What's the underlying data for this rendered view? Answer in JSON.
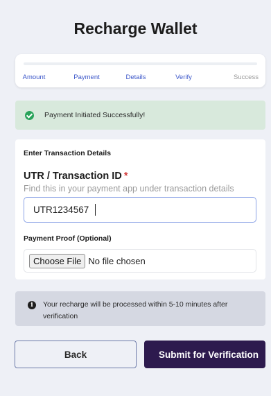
{
  "page": {
    "title": "Recharge Wallet"
  },
  "steps": [
    {
      "label": "Amount",
      "state": "done"
    },
    {
      "label": "Payment",
      "state": "done"
    },
    {
      "label": "Details",
      "state": "done"
    },
    {
      "label": "Verify",
      "state": "active"
    },
    {
      "label": "Success",
      "state": "pending"
    }
  ],
  "success_alert": {
    "message": "Payment Initiated Successfully!",
    "icon": "check-circle-icon"
  },
  "form": {
    "section_title": "Enter Transaction Details",
    "utr_label": "UTR / Transaction ID",
    "required_mark": "*",
    "utr_hint": "Find this in your payment app under transaction details",
    "utr_value": "UTR1234567",
    "proof_label": "Payment Proof (Optional)",
    "choose_file_label": "Choose File",
    "no_file_text": "No file chosen"
  },
  "info_alert": {
    "icon": "info-icon",
    "message": "Your recharge will be processed within 5-10 minutes after verification"
  },
  "buttons": {
    "back": "Back",
    "submit": "Submit for Verification"
  },
  "colors": {
    "accent": "#3c57c9",
    "primary_button": "#2d1a4e",
    "success": "#29a35a",
    "success_bg": "#d8e9dc",
    "info_bg": "#d5d8e2",
    "required": "#d23b3b"
  }
}
